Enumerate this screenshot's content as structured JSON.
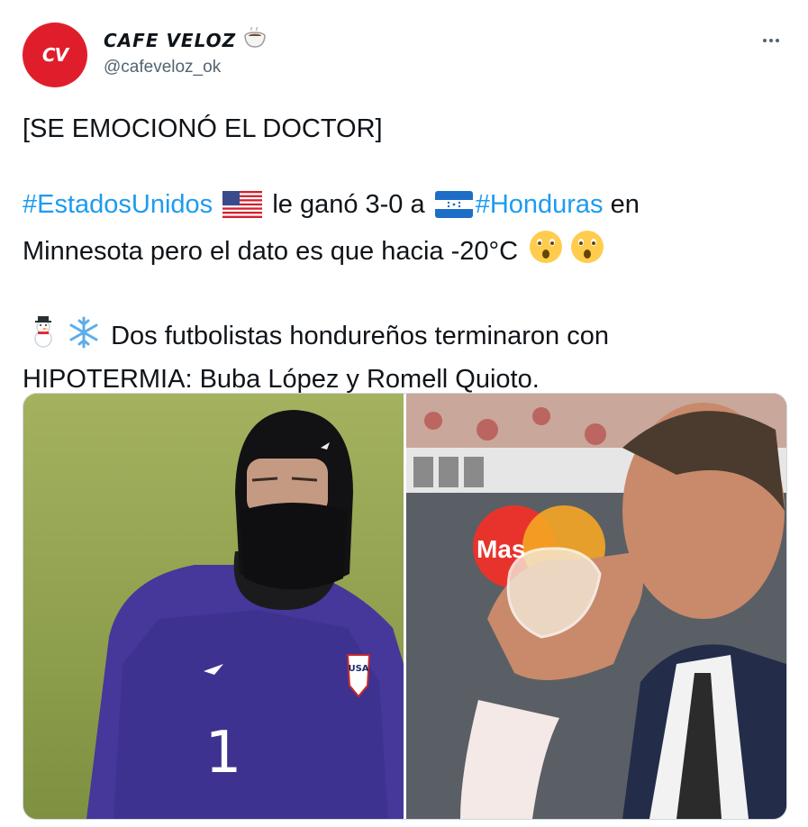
{
  "author": {
    "display_name": "CAFE VELOZ",
    "handle": "@cafeveloz_ok",
    "avatar_text": "CV",
    "avatar_color": "#e01e2b"
  },
  "tweet": {
    "headline": "[SE EMOCIONÓ EL DOCTOR]",
    "line2_tag1": "#EstadosUnidos",
    "line2_mid": "le ganó 3-0 a",
    "line2_tag2": "#Honduras",
    "line2_end": "en",
    "line3": "Minnesota pero el dato es que hacia -20°C",
    "line4": "Dos futbolistas hondureños terminaron con",
    "line5": "HIPOTERMIA: Buba López y Romell Quioto."
  },
  "media": {
    "left_photo": {
      "jersey_number": "1",
      "crest_text": "USA"
    },
    "right_photo": {
      "banner_text": "Mas"
    }
  },
  "colors": {
    "hashtag": "#1d9bf0",
    "text": "#0f1419",
    "secondary": "#536471"
  },
  "icons": [
    "coffee-cup-icon",
    "more-icon",
    "us-flag-icon",
    "honduras-flag-icon",
    "astonished-face-icon",
    "snowman-icon",
    "snowflake-icon"
  ]
}
